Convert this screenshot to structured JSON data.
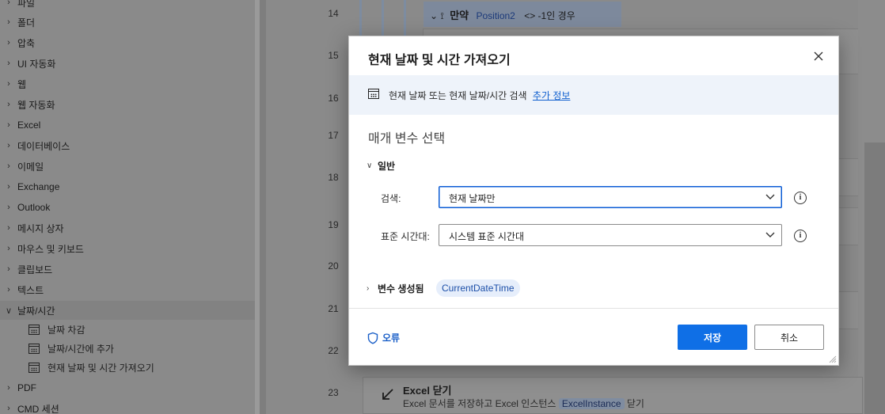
{
  "sidebar": {
    "items": [
      {
        "label": "파일",
        "expanded": false
      },
      {
        "label": "폴더",
        "expanded": false
      },
      {
        "label": "압축",
        "expanded": false
      },
      {
        "label": "UI 자동화",
        "expanded": false
      },
      {
        "label": "웹",
        "expanded": false
      },
      {
        "label": "웹 자동화",
        "expanded": false
      },
      {
        "label": "Excel",
        "expanded": false
      },
      {
        "label": "데이터베이스",
        "expanded": false
      },
      {
        "label": "이메일",
        "expanded": false
      },
      {
        "label": "Exchange",
        "expanded": false
      },
      {
        "label": "Outlook",
        "expanded": false
      },
      {
        "label": "메시지 상자",
        "expanded": false
      },
      {
        "label": "마우스 및 키보드",
        "expanded": false
      },
      {
        "label": "클립보드",
        "expanded": false
      },
      {
        "label": "텍스트",
        "expanded": false
      },
      {
        "label": "날짜/시간",
        "expanded": true
      },
      {
        "label": "PDF",
        "expanded": false
      },
      {
        "label": "CMD 세션",
        "expanded": false
      }
    ],
    "sub_items": [
      {
        "label": "날짜 차감",
        "icon": "calendar-icon"
      },
      {
        "label": "날짜/시간에 추가",
        "icon": "calendar-icon"
      },
      {
        "label": "현재 날짜 및 시간 가져오기",
        "icon": "calendar-icon"
      }
    ]
  },
  "flow": {
    "line_numbers": [
      "14",
      "15",
      "16",
      "17",
      "18",
      "19",
      "20",
      "21",
      "22",
      "23"
    ],
    "if_block": {
      "keyword": "만약",
      "variable": "Position2",
      "condition": "<> -1인 경우"
    },
    "excel_close": {
      "title": "Excel 닫기",
      "desc_prefix": "Excel 문서를 저장하고 Excel 인스턴스",
      "variable": "ExcelInstance",
      "desc_suffix": "닫기"
    }
  },
  "dialog": {
    "title": "현재 날짜 및 시간 가져오기",
    "info_text": "현재 날짜 또는 현재 날짜/시간 검색",
    "info_link": "추가 정보",
    "params_title": "매개 변수 선택",
    "general_section": "일반",
    "fields": [
      {
        "label": "검색:",
        "value": "현재 날짜만"
      },
      {
        "label": "표준 시간대:",
        "value": "시스템 표준 시간대"
      }
    ],
    "variables_section": "변수 생성됨",
    "variable_chip": "CurrentDateTime",
    "error_label": "오류",
    "save_label": "저장",
    "cancel_label": "취소"
  },
  "colors": {
    "primary": "#0f6fe6",
    "link": "#0f5fcf",
    "info_banner": "#eef3fa",
    "overlay": "#8a8a8a"
  }
}
